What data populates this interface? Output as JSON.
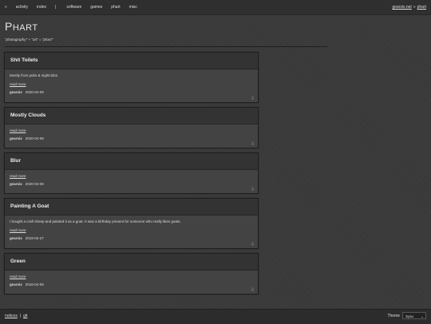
{
  "nav": {
    "home": "«",
    "items": [
      "activity",
      "index",
      "|",
      "software",
      "games",
      "phart",
      "misc"
    ]
  },
  "breadcrumb": {
    "site": "gearsix.net",
    "sep": "»",
    "page": "phart"
  },
  "header": {
    "title_first": "P",
    "title_rest": "HART",
    "tagline": "\"photography\" + \"art\" = \"phart\""
  },
  "posts": [
    {
      "title": "Shit Toilets",
      "summary": "Mostly from pubs & nightclubs.",
      "read_more": "read more",
      "author": "gearsix",
      "date": "2020-04-09",
      "arrow": "⇩"
    },
    {
      "title": "Mostly Clouds",
      "summary": "",
      "read_more": "read more",
      "author": "gearsix",
      "date": "2020-04-09",
      "arrow": "⇩"
    },
    {
      "title": "Blur",
      "summary": "",
      "read_more": "read more",
      "author": "gearsix",
      "date": "2020-04-09",
      "arrow": "⇩"
    },
    {
      "title": "Painting A Goat",
      "summary": "I bought a craft sheep and painted it as a goat. It was a birthday present for someone who really likes goats.",
      "read_more": "read more",
      "author": "gearsix",
      "date": "2019-02-27",
      "arrow": "⇩"
    },
    {
      "title": "Green",
      "summary": "",
      "read_more": "read more",
      "author": "gearsix",
      "date": "2016-04-09",
      "arrow": "⇩"
    }
  ],
  "footer": {
    "links": [
      "notices",
      "git"
    ],
    "theme_label": "Theme",
    "theme_value": "Sysu",
    "chevron": "⌄"
  }
}
